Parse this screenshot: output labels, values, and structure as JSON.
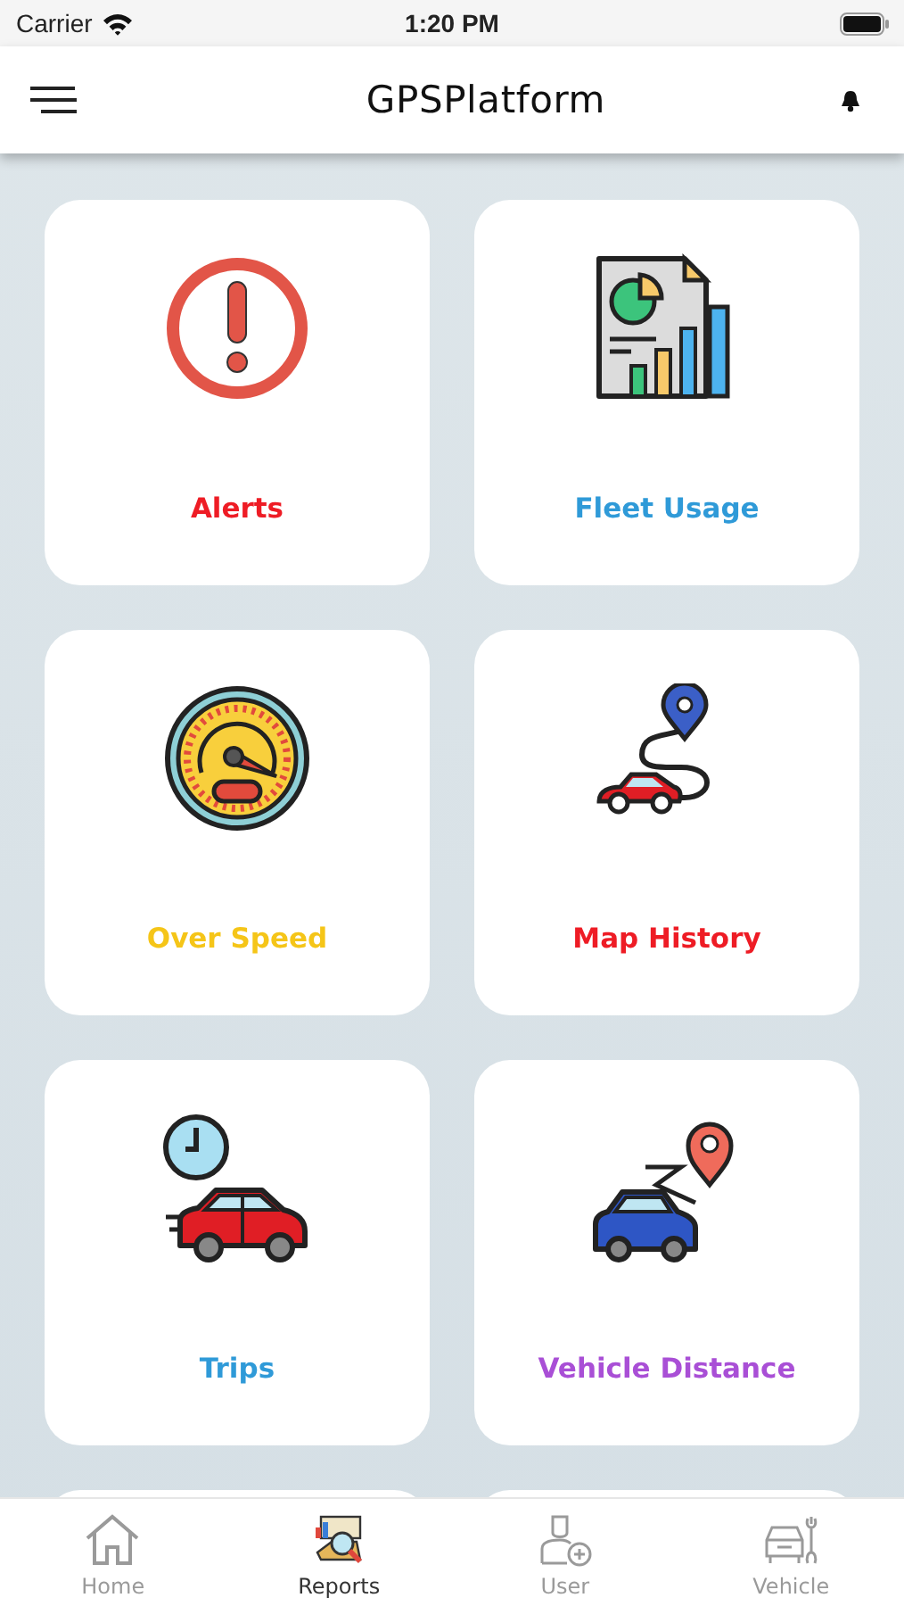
{
  "status_bar": {
    "carrier": "Carrier",
    "time": "1:20 PM"
  },
  "header": {
    "title": "GPSPlatform"
  },
  "cards": [
    {
      "kind": "alert",
      "label": "Alerts",
      "color": "#ee1c25"
    },
    {
      "kind": "fleet",
      "label": "Fleet Usage",
      "color": "#2f9ad8"
    },
    {
      "kind": "speed",
      "label": "Over Speed",
      "color": "#f5c518"
    },
    {
      "kind": "map",
      "label": "Map History",
      "color": "#ee1c25"
    },
    {
      "kind": "trips",
      "label": "Trips",
      "color": "#2f9ad8"
    },
    {
      "kind": "distance",
      "label": "Vehicle Distance",
      "color": "#a94fd6"
    },
    {
      "kind": "partial"
    },
    {
      "kind": "partial"
    }
  ],
  "tabs": [
    {
      "kind": "home",
      "label": "Home",
      "selected": false
    },
    {
      "kind": "reports",
      "label": "Reports",
      "selected": true
    },
    {
      "kind": "user",
      "label": "User",
      "selected": false
    },
    {
      "kind": "vehicle",
      "label": "Vehicle",
      "selected": false
    }
  ]
}
